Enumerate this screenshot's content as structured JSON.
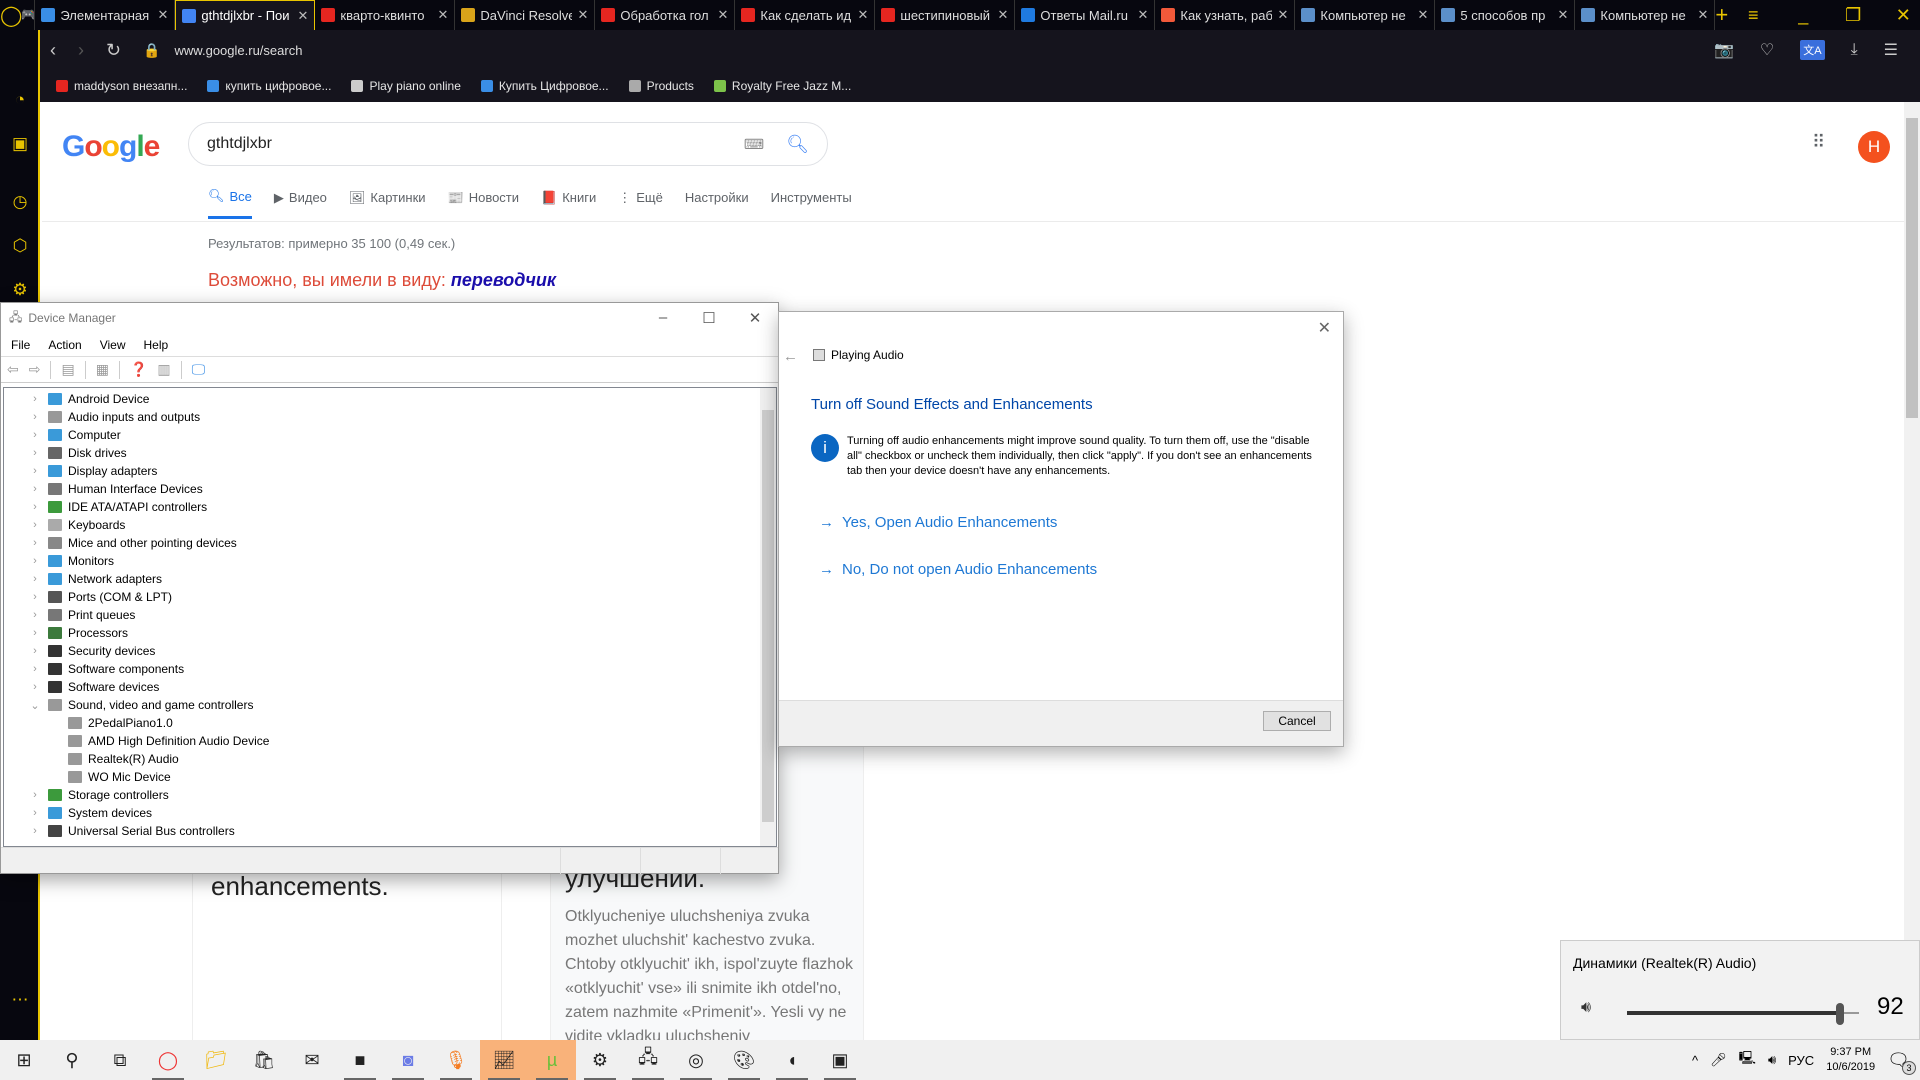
{
  "browser": {
    "tabs": [
      {
        "title": "Элементарная",
        "color": "#3a8ee6"
      },
      {
        "title": "gthtdjlxbr - Пои",
        "color": "#4285f4",
        "active": true
      },
      {
        "title": "кварто-квинто",
        "color": "#e52620"
      },
      {
        "title": "DaVinci Resolve",
        "color": "#d8a31a"
      },
      {
        "title": "Обработка гол",
        "color": "#e52620"
      },
      {
        "title": "Как сделать ид",
        "color": "#e52620"
      },
      {
        "title": "шестипиновый",
        "color": "#e52620"
      },
      {
        "title": "Ответы Mail.ru",
        "color": "#1f7ae0"
      },
      {
        "title": "Как узнать, раб",
        "color": "#f2593a"
      },
      {
        "title": "Компьютер не",
        "color": "#5b8fc9"
      },
      {
        "title": "5 способов пр",
        "color": "#5b8fc9"
      },
      {
        "title": "Компьютер не",
        "color": "#5b8fc9"
      }
    ],
    "url": "www.google.ru/search",
    "bookmarks": [
      {
        "label": "maddyson внезапн...",
        "color": "#e52620"
      },
      {
        "label": "купить цифровое...",
        "color": "#3a8ee6"
      },
      {
        "label": "Play piano online",
        "color": "#ccc"
      },
      {
        "label": "Купить Цифровое...",
        "color": "#3a8ee6"
      },
      {
        "label": "Products",
        "color": "#aaa"
      },
      {
        "label": "Royalty Free Jazz M...",
        "color": "#7cc24a"
      }
    ],
    "accent": "#e8c400"
  },
  "google": {
    "logo": "Google",
    "query": "gthtdjlxbr",
    "tabs": [
      "Все",
      "Видео",
      "Картинки",
      "Новости",
      "Книги",
      "Ещё",
      "Настройки",
      "Инструменты"
    ],
    "stats": "Результатов: примерно 35 100 (0,49 сек.)",
    "did_you_mean": "Возможно, вы имели в виду:",
    "suggestion": "переводчик",
    "avatar": "H",
    "card_a_heading": "enhancements.",
    "card_b_heading": "улучшений.",
    "card_b_text": "Otklyucheniye uluchsheniya zvuka mozhet uluchshit' kachestvo zvuka. Chtoby otklyuchit' ikh, ispol'zuyte flazhok «otklyuchit' vse» ili snimite ikh otdel'no, zatem nazhmite «Primenit'». Yesli vy ne vidite vkladku uluchsheniy"
  },
  "device_manager": {
    "title": "Device Manager",
    "menu": [
      "File",
      "Action",
      "View",
      "Help"
    ],
    "nodes": [
      {
        "label": "Android Device",
        "color": "#3a9ad9"
      },
      {
        "label": "Audio inputs and outputs",
        "color": "#999"
      },
      {
        "label": "Computer",
        "color": "#3a9ad9"
      },
      {
        "label": "Disk drives",
        "color": "#666"
      },
      {
        "label": "Display adapters",
        "color": "#3a9ad9"
      },
      {
        "label": "Human Interface Devices",
        "color": "#777"
      },
      {
        "label": "IDE ATA/ATAPI controllers",
        "color": "#3c9a3c"
      },
      {
        "label": "Keyboards",
        "color": "#aaa"
      },
      {
        "label": "Mice and other pointing devices",
        "color": "#888"
      },
      {
        "label": "Monitors",
        "color": "#3a9ad9"
      },
      {
        "label": "Network adapters",
        "color": "#3a9ad9"
      },
      {
        "label": "Ports (COM & LPT)",
        "color": "#555"
      },
      {
        "label": "Print queues",
        "color": "#777"
      },
      {
        "label": "Processors",
        "color": "#3c7a3c"
      },
      {
        "label": "Security devices",
        "color": "#333"
      },
      {
        "label": "Software components",
        "color": "#333"
      },
      {
        "label": "Software devices",
        "color": "#333"
      },
      {
        "label": "Sound, video and game controllers",
        "color": "#999",
        "expanded": true
      },
      {
        "label": "2PedalPiano1.0",
        "color": "#999",
        "child": true
      },
      {
        "label": "AMD High Definition Audio Device",
        "color": "#999",
        "child": true
      },
      {
        "label": "Realtek(R) Audio",
        "color": "#999",
        "child": true
      },
      {
        "label": "WO Mic Device",
        "color": "#999",
        "child": true
      },
      {
        "label": "Storage controllers",
        "color": "#3c9a3c"
      },
      {
        "label": "System devices",
        "color": "#3a9ad9"
      },
      {
        "label": "Universal Serial Bus controllers",
        "color": "#444"
      }
    ]
  },
  "troubleshooter": {
    "header": "Playing Audio",
    "title": "Turn off Sound Effects and Enhancements",
    "info": "Turning off audio enhancements might improve sound quality. To turn them off, use the \"disable all\" checkbox or uncheck them individually, then click \"apply\". If you don't see an enhancements tab then your device doesn't have any enhancements.",
    "option_yes": "Yes, Open Audio Enhancements",
    "option_no": "No, Do not open Audio Enhancements",
    "cancel": "Cancel"
  },
  "volume": {
    "device": "Динамики (Realtek(R) Audio)",
    "level": 92
  },
  "taskbar": {
    "lang": "РУС",
    "time": "9:37 PM",
    "date": "10/6/2019",
    "notifications": "3"
  }
}
